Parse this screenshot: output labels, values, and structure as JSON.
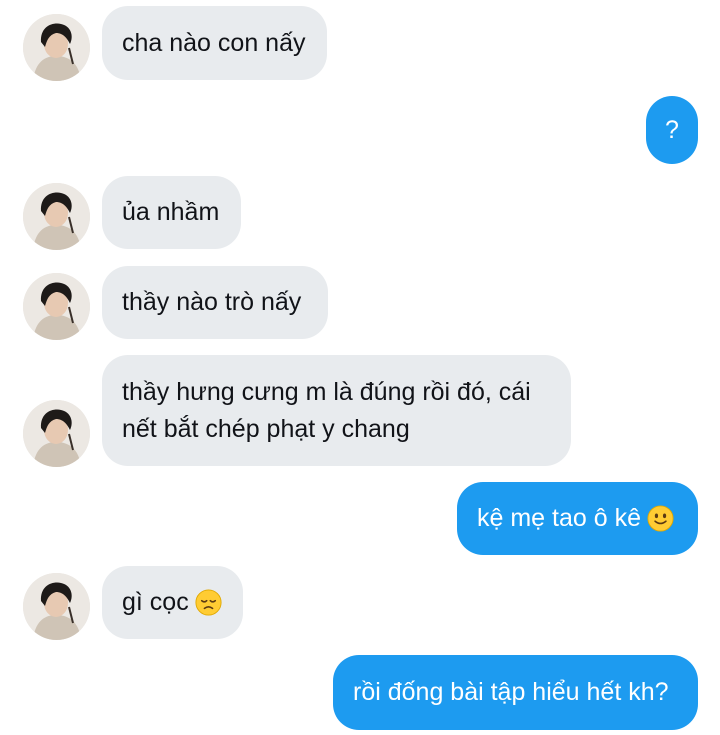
{
  "colors": {
    "incoming_bubble": "#e8ebee",
    "outgoing_bubble": "#1d9bf0",
    "incoming_text": "#111318",
    "outgoing_text": "#ffffff"
  },
  "messages": [
    {
      "direction": "incoming",
      "text": "cha nào con nấy"
    },
    {
      "direction": "outgoing",
      "text": "?"
    },
    {
      "direction": "incoming",
      "text": "ủa nhầm"
    },
    {
      "direction": "incoming",
      "text": "thầy nào trò nấy"
    },
    {
      "direction": "incoming",
      "lines": [
        "thầy hưng cưng m là đúng rồi đó, cái",
        "nết bắt chép phạt y chang"
      ]
    },
    {
      "direction": "outgoing",
      "text": "kệ mẹ tao ô kê",
      "emoji": "slightly-smiling-face-icon"
    },
    {
      "direction": "incoming",
      "text": "gì cọc",
      "emoji": "disappointed-face-icon"
    },
    {
      "direction": "outgoing",
      "text": "rồi đống bài tập hiểu hết kh?"
    }
  ]
}
